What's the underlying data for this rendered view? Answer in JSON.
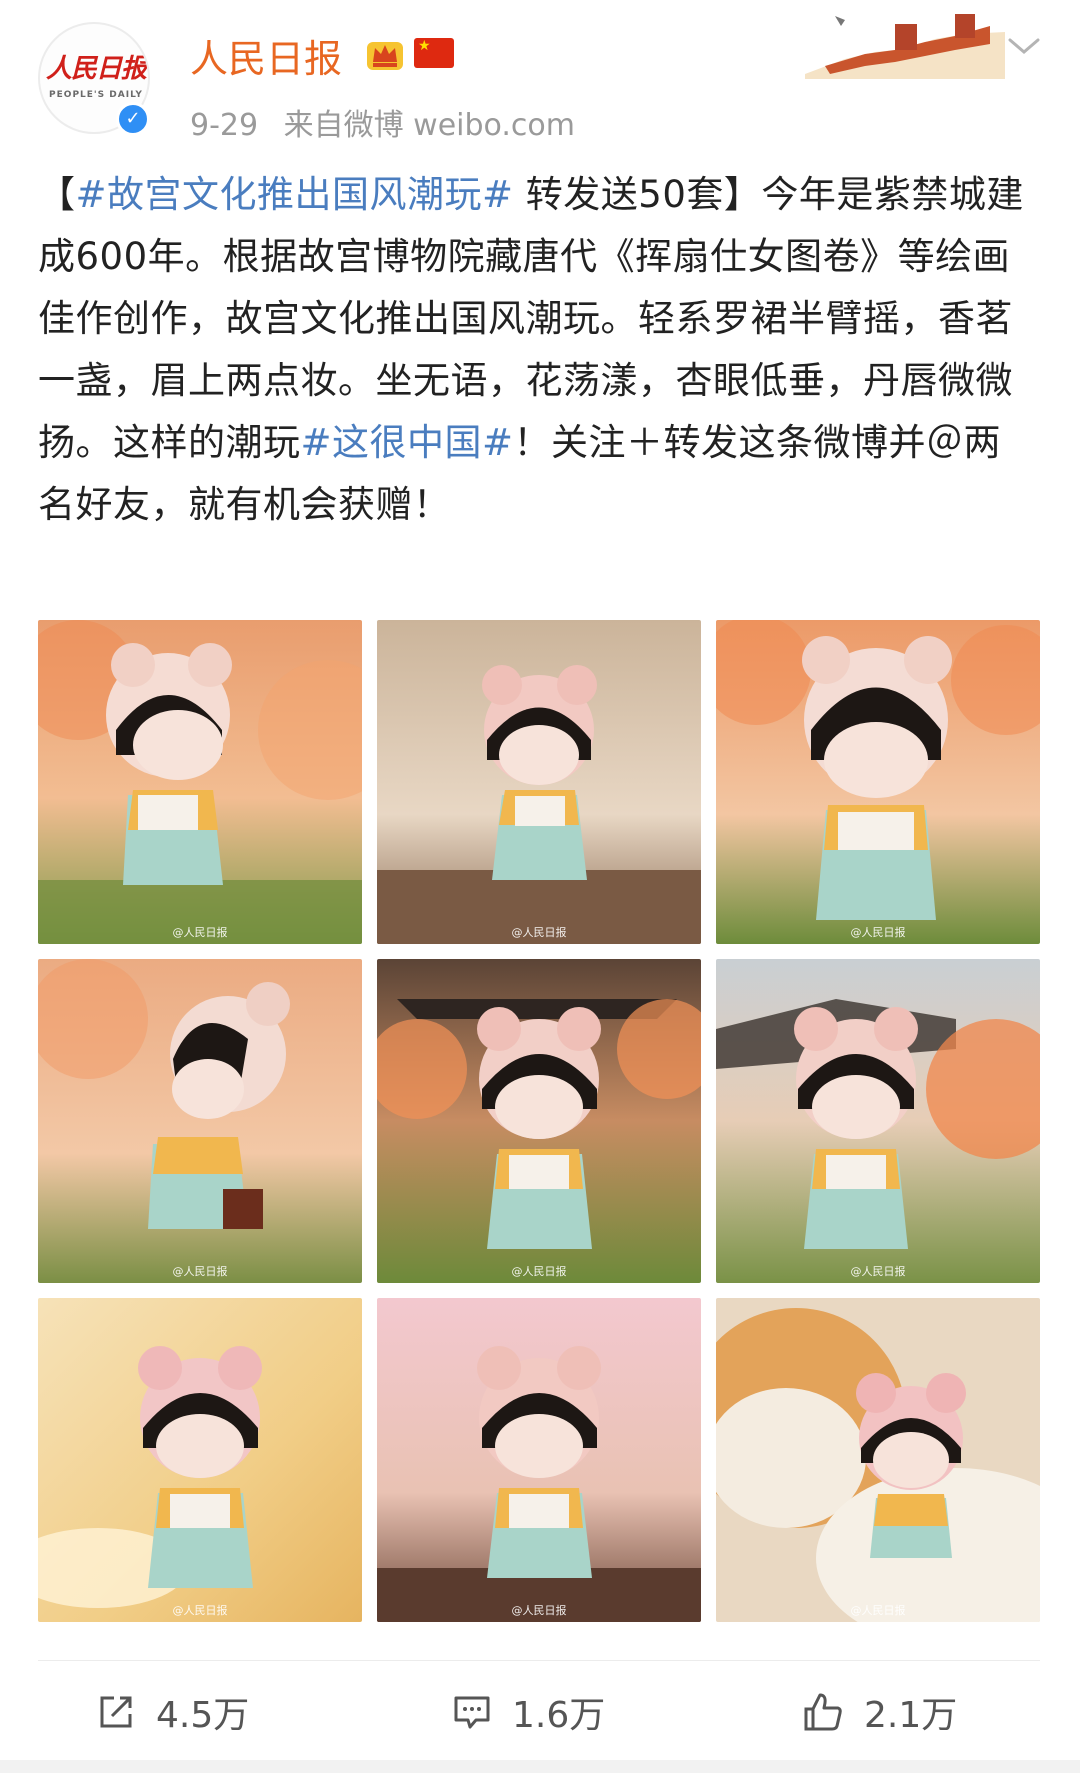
{
  "user": {
    "avatar_logo_cn": "人民日报",
    "avatar_logo_en": "PEOPLE'S DAILY",
    "name": "人民日报",
    "date": "9-29",
    "source": "来自微博 weibo.com"
  },
  "post": {
    "open_bracket": "【",
    "tag1": "#故宫文化推出国风潮玩#",
    "part1": " 转发送50套】今年是紫禁城建成600年。根据故宫博物院藏唐代《挥扇仕女图卷》等绘画佳作创作，故宫文化推出国风潮玩。轻系罗裙半臂摇，香茗一盏，眉上两点妆。坐无语，花荡漾，杏眼低垂，丹唇微微扬。这样的潮玩",
    "tag2": "#这很中国#",
    "part2": "！关注＋转发这条微博并＠两名好友，就有机会获赠！"
  },
  "images": {
    "watermark": "@人民日报",
    "items": [
      {
        "scene": "blossom-seated"
      },
      {
        "scene": "interior-front"
      },
      {
        "scene": "blossom-closeup"
      },
      {
        "scene": "blossom-side"
      },
      {
        "scene": "pavilion-front"
      },
      {
        "scene": "garden-tree"
      },
      {
        "scene": "golden-plate"
      },
      {
        "scene": "pink-soft"
      },
      {
        "scene": "cat-fur"
      }
    ]
  },
  "actions": {
    "repost_count": "4.5万",
    "comment_count": "1.6万",
    "like_count": "2.1万"
  },
  "colors": {
    "username": "#e86722",
    "hashtag": "#4a7dbf",
    "verified": "#2f8ff5"
  }
}
